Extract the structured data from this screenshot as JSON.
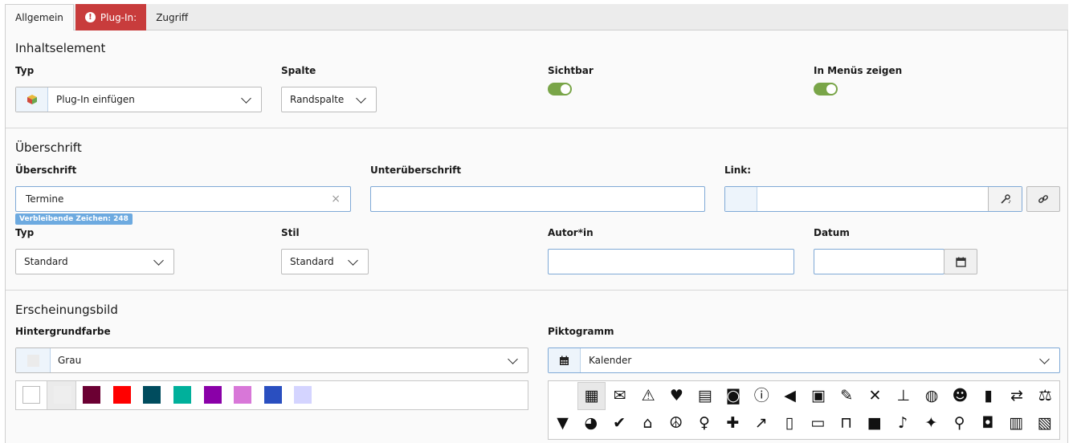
{
  "tabs": [
    {
      "label": "Allgemein"
    },
    {
      "label": "Plug-In:",
      "error": true
    },
    {
      "label": "Zugriff"
    }
  ],
  "inhaltselement": {
    "title": "Inhaltselement",
    "typ_label": "Typ",
    "typ_value": "Plug-In einfügen",
    "spalte_label": "Spalte",
    "spalte_value": "Randspalte",
    "sichtbar_label": "Sichtbar",
    "menus_label": "In Menüs zeigen"
  },
  "ueberschrift": {
    "title": "Überschrift",
    "label": "Überschrift",
    "value": "Termine",
    "remaining": "Verbleibende Zeichen: 248",
    "unter_label": "Unterüberschrift",
    "link_label": "Link:",
    "typ_label": "Typ",
    "typ_value": "Standard",
    "stil_label": "Stil",
    "stil_value": "Standard",
    "autor_label": "Autor*in",
    "datum_label": "Datum"
  },
  "erscheinung": {
    "title": "Erscheinungsbild",
    "hintergrund_label": "Hintergrundfarbe",
    "hintergrund_value": "Grau",
    "hintergrund_color": "#eeeeee",
    "swatches": [
      "#ffffff",
      "#eeeeee",
      "#6b0033",
      "#ff0000",
      "#004c5e",
      "#00b09b",
      "#8a00a8",
      "#d877d8",
      "#2a4fc0",
      "#d4d4ff"
    ],
    "pikto_label": "Piktogramm",
    "pikto_value": "Kalender",
    "icons_row1": [
      "calendar",
      "envelope",
      "warning",
      "heart",
      "newspaper",
      "rss",
      "info",
      "bullhorn",
      "money",
      "pencil",
      "times",
      "thumbtack",
      "globe",
      "smile",
      "file",
      "handshake",
      "balance-scale"
    ],
    "icons_row2": [
      "bookmark",
      "chart-pie",
      "check-circle",
      "home",
      "peace",
      "venus",
      "ambulance",
      "syringe",
      "mobile",
      "desktop",
      "laptop",
      "video",
      "microphone",
      "lightbulb",
      "bicycle",
      "car",
      "train",
      "bus"
    ]
  }
}
